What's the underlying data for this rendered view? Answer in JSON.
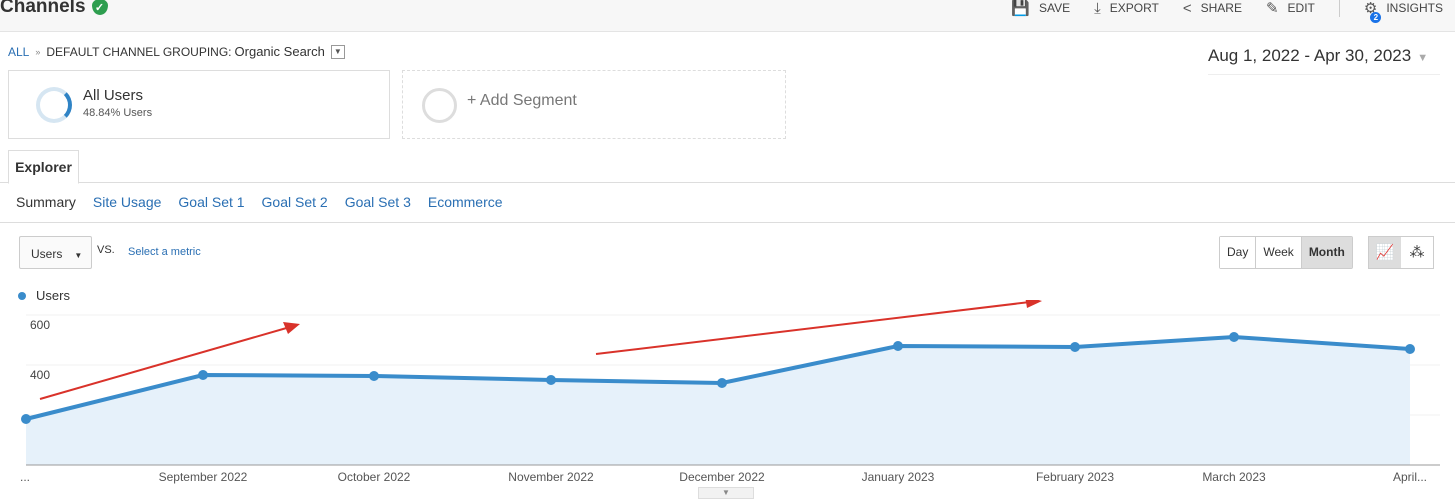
{
  "header": {
    "title": "Channels",
    "actions": [
      {
        "label": "SAVE",
        "icon": "save-icon"
      },
      {
        "label": "EXPORT",
        "icon": "download-icon"
      },
      {
        "label": "SHARE",
        "icon": "share-icon"
      },
      {
        "label": "EDIT",
        "icon": "pencil-icon"
      },
      {
        "label": "INSIGHTS",
        "icon": "insights-icon",
        "badge": "2"
      }
    ]
  },
  "breadcrumb": {
    "all": "ALL",
    "sep": "»",
    "dimension": "DEFAULT CHANNEL GROUPING:",
    "value": "Organic Search"
  },
  "date_range": "Aug 1, 2022 - Apr 30, 2023",
  "segments": {
    "active": {
      "name": "All Users",
      "detail": "48.84% Users"
    },
    "add": "+ Add Segment"
  },
  "tabs": {
    "explorer": "Explorer",
    "sub": [
      "Summary",
      "Site Usage",
      "Goal Set 1",
      "Goal Set 2",
      "Goal Set 3",
      "Ecommerce"
    ]
  },
  "metric": {
    "selected": "Users",
    "vs": "VS.",
    "select": "Select a metric"
  },
  "period": [
    "Day",
    "Week",
    "Month"
  ],
  "period_selected": "Month",
  "colors": {
    "line": "#3a8ccb",
    "fill": "#e6f1fa",
    "arrow": "#d9322a",
    "link": "#2a6fb3"
  },
  "chart_data": {
    "type": "line",
    "title": "",
    "legend": [
      "Users"
    ],
    "ylabel": "",
    "xlabel": "",
    "y_ticks": [
      200,
      400,
      600
    ],
    "ylim": [
      0,
      600
    ],
    "categories": [
      "...",
      "September 2022",
      "October 2022",
      "November 2022",
      "December 2022",
      "January 2023",
      "February 2023",
      "March 2023",
      "April..."
    ],
    "series": [
      {
        "name": "Users",
        "values": [
          184,
          360,
          356,
          340,
          328,
          476,
          472,
          512,
          464
        ]
      }
    ],
    "annotations": [
      "two red upward trend arrows"
    ]
  }
}
